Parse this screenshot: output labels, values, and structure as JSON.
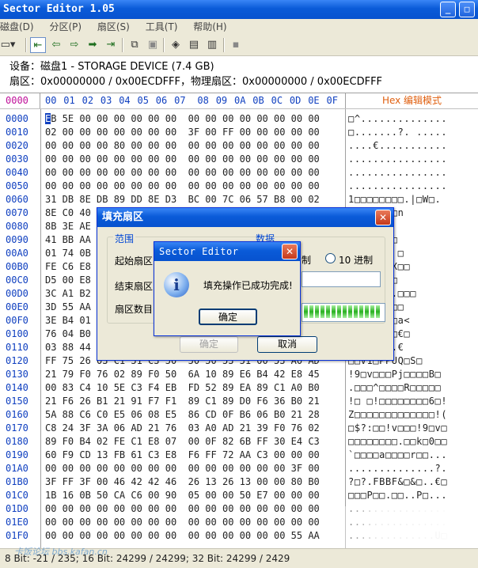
{
  "app": {
    "title": "Sector Editor 1.05"
  },
  "menu": [
    "磁盘(D)",
    "分区(P)",
    "扇区(S)",
    "工具(T)",
    "帮助(H)"
  ],
  "device": {
    "line1": "设备：磁盘1 - STORAGE DEVICE   (7.4 GB)",
    "line2": "扇区：0x00000000 / 0x00ECDFFF，物理扇区：0x00000000 / 0x00ECDFFF"
  },
  "header": {
    "offset_label": "0000",
    "columns": [
      "00",
      "01",
      "02",
      "03",
      "04",
      "05",
      "06",
      "07",
      "08",
      "09",
      "0A",
      "0B",
      "0C",
      "0D",
      "0E",
      "0F"
    ],
    "mode_label": "Hex 编辑模式"
  },
  "rows": [
    {
      "addr": "0000",
      "hex": "EB 5E 00 00 00 00 00 00  00 00 00 00 00 00 00 00",
      "ascii": "□^.............."
    },
    {
      "addr": "0010",
      "hex": "02 00 00 00 00 00 00 00  3F 00 FF 00 00 00 00 00",
      "ascii": "□.......?. ....."
    },
    {
      "addr": "0020",
      "hex": "00 00 00 00 80 00 00 00  00 00 00 00 00 00 00 00",
      "ascii": "....€..........."
    },
    {
      "addr": "0030",
      "hex": "00 00 00 00 00 00 00 00  00 00 00 00 00 00 00 00",
      "ascii": "................"
    },
    {
      "addr": "0040",
      "hex": "00 00 00 00 00 00 00 00  00 00 00 00 00 00 00 00",
      "ascii": "................"
    },
    {
      "addr": "0050",
      "hex": "00 00 00 00 00 00 00 00  00 00 00 00 00 00 00 00",
      "ascii": "................"
    },
    {
      "addr": "0060",
      "hex": "31 DB 8E DB 89 DD 8E D3  BC 00 7C 06 57 B8 00 02",
      "ascii": "1□□□□□□□□.|□W□."
    },
    {
      "addr": "0070",
      "hex": "8E C0 40 ...",
      "ascii": "□□o□□□□□n"
    },
    {
      "addr": "0080",
      "hex": "8B 3E AE ...",
      "ascii": "□€>□!€s"
    },
    {
      "addr": "0090",
      "hex": "41 BB AA ...",
      "ascii": "r□□□U□u□"
    },
    {
      "addr": "00A0",
      "hex": "01 74 0B ...",
      "ascii": "□z.a□□□ □"
    },
    {
      "addr": "00B0",
      "hex": "FE C6 E8 ...",
      "ascii": "□P$.□□!X□□"
    },
    {
      "addr": "00C0",
      "hex": "D5 00 E8 ...",
      "ascii": "6□!□□!□□"
    },
    {
      "addr": "00D0",
      "hex": "3C A1 B2 ...",
      "ascii": "□A.□□#..□□□"
    },
    {
      "addr": "00E0",
      "hex": "3D 55 AA ...",
      "ascii": "□□.□□#)□□"
    },
    {
      "addr": "00F0",
      "hex": "3E B4 01 ...",
      "ascii": "uO□`1□□□a<"
    },
    {
      "addr": "0100",
      "hex": "76 04 B0 ...",
      "ascii": "□□<□v□□□€□"
    },
    {
      "addr": "0110",
      "hex": "03 88 44 ...",
      "ascii": "!□m)□□□.€"
    },
    {
      "addr": "0120",
      "hex": "FF 75 26 03 C1 51 C3 50  50 50 53 51 00 53 A0 AD",
      "ascii": "□□V1□PPUQ□S□"
    },
    {
      "addr": "0130",
      "hex": "21 79 F0 76 02 89 F0 50  6A 10 89 E6 B4 42 E8 45",
      "ascii": "!9□v□□□Pj□□□□B□"
    },
    {
      "addr": "0140",
      "hex": "00 83 C4 10 5E C3 F4 EB  FD 52 89 EA 89 C1 A0 B0",
      "ascii": ".□□□^□□□□R□□□□□"
    },
    {
      "addr": "0150",
      "hex": "21 F6 26 B1 21 91 F7 F1  89 C1 89 D0 F6 36 B0 21",
      "ascii": "!□ □!□□□□□□□□6□!"
    },
    {
      "addr": "0160",
      "hex": "5A 88 C6 C0 E5 06 08 E5  86 CD 0F B6 06 B0 21 28",
      "ascii": "Z□□□□□□□□□□□□□!("
    },
    {
      "addr": "0170",
      "hex": "C8 24 3F 3A 06 AD 21 76  03 A0 AD 21 39 F0 76 02",
      "ascii": "□$?:□□!v□□□!9□v□"
    },
    {
      "addr": "0180",
      "hex": "89 F0 B4 02 FE C1 E8 07  00 0F 82 6B FF 30 E4 C3",
      "ascii": "□□□□□□□□.□□k□0□□"
    },
    {
      "addr": "0190",
      "hex": "60 F9 CD 13 FB 61 C3 E8  F6 FF 72 AA C3 00 00 00",
      "ascii": "`□□□□a□□□□r□□..."
    },
    {
      "addr": "01A0",
      "hex": "00 00 00 00 00 00 00 00  00 00 00 00 00 00 3F 00",
      "ascii": "..............?."
    },
    {
      "addr": "01B0",
      "hex": "3F FF 3F 00 46 42 42 46  26 13 26 13 00 00 80 B0",
      "ascii": "?□?.FBBF&□&□..€□"
    },
    {
      "addr": "01C0",
      "hex": "1B 16 0B 50 CA C6 00 90  05 00 00 50 E7 00 00 00",
      "ascii": "□□□P□□.□□..P□..."
    },
    {
      "addr": "01D0",
      "hex": "00 00 00 00 00 00 00 00  00 00 00 00 00 00 00 00",
      "ascii": "................"
    },
    {
      "addr": "01E0",
      "hex": "00 00 00 00 00 00 00 00  00 00 00 00 00 00 00 00",
      "ascii": "................"
    },
    {
      "addr": "01F0",
      "hex": "00 00 00 00 00 00 00 00  00 00 00 00 00 00 55 AA",
      "ascii": "..............U□"
    }
  ],
  "status": {
    "text": "8 Bit: -21 / 235;   16 Bit: 24299 / 24299;   32 Bit: 24299 / 2429"
  },
  "watermark": "卡饭论坛 bbs.kafan.cn",
  "fill_dialog": {
    "title": "填充扇区",
    "group_range": "范围",
    "group_data": "数据",
    "start_label": "起始扇区",
    "end_label": "结束扇区",
    "count_label": "扇区数目",
    "radio_hex": "制",
    "radio_dec": "10 进制",
    "progress": 1.0,
    "ok": "确定",
    "cancel": "取消"
  },
  "msg_dialog": {
    "title": "Sector Editor",
    "message": "填充操作已成功完成!",
    "ok": "确定"
  }
}
